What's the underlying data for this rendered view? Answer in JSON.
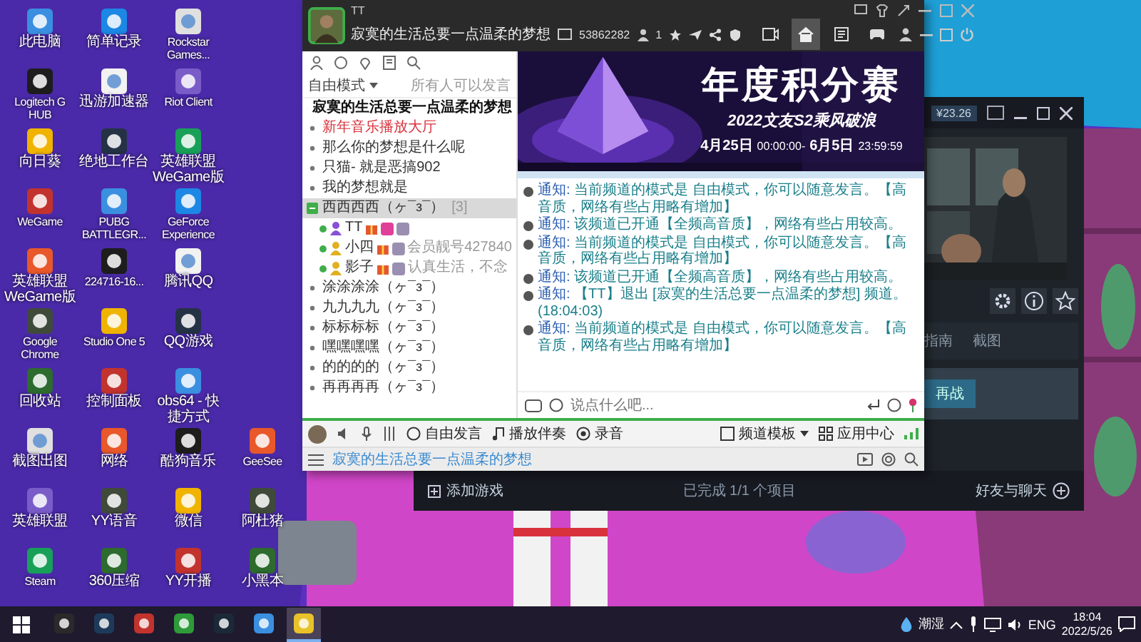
{
  "desktop": {
    "icon_columns": [
      [
        {
          "label": "此电脑"
        },
        {
          "label": "Logitech G HUB"
        },
        {
          "label": "向日葵"
        },
        {
          "label": "WeGame"
        },
        {
          "label": "英雄联盟 WeGame版"
        },
        {
          "label": "Google Chrome"
        },
        {
          "label": "回收站"
        },
        {
          "label": "截图出图"
        },
        {
          "label": "英雄联盟"
        },
        {
          "label": "Steam"
        }
      ],
      [
        {
          "label": "简单记录"
        },
        {
          "label": "迅游加速器"
        },
        {
          "label": "绝地工作台"
        },
        {
          "label": "PUBG BATTLEGR..."
        },
        {
          "label": "224716-16..."
        },
        {
          "label": "Studio One 5"
        },
        {
          "label": "控制面板"
        },
        {
          "label": "网络"
        },
        {
          "label": "YY语音"
        },
        {
          "label": "360压缩"
        }
      ],
      [
        {
          "label": "Rockstar Games..."
        },
        {
          "label": "Riot Client"
        },
        {
          "label": "英雄联盟 WeGame版"
        },
        {
          "label": "GeForce Experience"
        },
        {
          "label": "腾讯QQ"
        },
        {
          "label": "QQ游戏"
        },
        {
          "label": "obs64 - 快捷方式"
        },
        {
          "label": "酷狗音乐"
        },
        {
          "label": "微信"
        },
        {
          "label": "YY开播"
        }
      ],
      [
        {
          "label": "GeeSee"
        },
        {
          "label": "阿杜猪"
        },
        {
          "label": "小黑本"
        }
      ]
    ]
  },
  "chat_window": {
    "user_tag": "TT",
    "channel_title": "寂寞的生活总要一点温柔的梦想",
    "channel_id": "53862282",
    "online_count": "1",
    "nav": [
      {
        "selected": false
      },
      {
        "selected": true
      },
      {
        "selected": false
      },
      {
        "selected": false
      }
    ],
    "mode": "自由模式",
    "mode_note": "所有人可以发言",
    "channels": [
      {
        "kind": "root",
        "name": "寂寞的生活总要一点温柔的梦想",
        "color": "#111111",
        "selected": false,
        "expanded": false
      },
      {
        "kind": "channel",
        "name": "新年音乐播放大厅",
        "color": "#d8323c",
        "selected": false,
        "expanded": false
      },
      {
        "kind": "channel",
        "name": "那么你的梦想是什么呢",
        "color": "#333333",
        "selected": false,
        "expanded": false
      },
      {
        "kind": "channel",
        "name": "只猫- 就是恶搞902",
        "color": "#333333",
        "selected": false,
        "expanded": false
      },
      {
        "kind": "channel",
        "name": "我的梦想就是",
        "color": "#333333",
        "selected": false,
        "expanded": false
      },
      {
        "kind": "group",
        "name": "西西西西（ヶ¯з¯）",
        "count": "[3]",
        "color": "#333333",
        "selected": true,
        "expanded": true,
        "children": [
          {
            "name": "TT",
            "kind": "admin"
          },
          {
            "name": "小四",
            "kind": "member",
            "note": "会员靓号427840"
          },
          {
            "name": "影子",
            "kind": "member",
            "note": "认真生活，不念"
          }
        ]
      },
      {
        "kind": "channel",
        "name": "涂涂涂涂（ヶ¯з¯）",
        "color": "#333333",
        "selected": false,
        "expanded": false
      },
      {
        "kind": "channel",
        "name": "九九九九（ヶ¯з¯）",
        "color": "#333333",
        "selected": false,
        "expanded": false
      },
      {
        "kind": "channel",
        "name": "标标标标（ヶ¯з¯）",
        "color": "#333333",
        "selected": false,
        "expanded": false
      },
      {
        "kind": "channel",
        "name": "嘿嘿嘿嘿（ヶ¯з¯）",
        "color": "#333333",
        "selected": false,
        "expanded": false
      },
      {
        "kind": "channel",
        "name": "的的的的（ヶ¯з¯）",
        "color": "#333333",
        "selected": false,
        "expanded": false
      },
      {
        "kind": "channel",
        "name": "再再再再（ヶ¯з¯）",
        "color": "#333333",
        "selected": false,
        "expanded": false
      }
    ],
    "banner": {
      "title": "年度积分赛",
      "subtitle": "2022文友S2乘风破浪",
      "start_date": "4月25日",
      "start_time": "00:00:00-",
      "end_date": "6月5日",
      "end_time": "23:59:59"
    },
    "messages": [
      {
        "label": "通知:",
        "text": "当前频道的模式是 自由模式，你可以随意发言。【高音质，网络有些占用略有增加】"
      },
      {
        "label": "通知:",
        "text": "该频道已开通【全频高音质】，网络有些占用较高。"
      },
      {
        "label": "通知:",
        "text": "当前频道的模式是 自由模式，你可以随意发言。【高音质，网络有些占用略有增加】"
      },
      {
        "label": "通知:",
        "text": "该频道已开通【全频高音质】，网络有些占用较高。"
      },
      {
        "label": "通知:",
        "text": "【TT】退出 [寂寞的生活总要一点温柔的梦想] 频道。(18:04:03)"
      },
      {
        "label": "通知:",
        "text": "当前频道的模式是 自由模式，你可以随意发言。【高音质，网络有些占用略有增加】"
      }
    ],
    "input": {
      "placeholder": "说点什么吧..."
    },
    "toolbar": {
      "speak_mode": "自由发言",
      "accompaniment": "播放伴奏",
      "record": "录音",
      "template": "频道模板",
      "apps": "应用中心"
    },
    "footer_link": "寂寞的生活总要一点温柔的梦想"
  },
  "steam_window": {
    "balance": "¥23.26",
    "tabs": [
      {
        "label": "指南",
        "selected": false
      },
      {
        "label": "截图",
        "selected": false
      }
    ],
    "action": "再战",
    "add_game": "添加游戏",
    "downloads": "已完成 1/1 个项目",
    "friends": "好友与聊天"
  },
  "taskbar": {
    "apps": [
      {
        "selected": false
      },
      {
        "selected": false
      },
      {
        "selected": false
      },
      {
        "selected": false
      },
      {
        "selected": false
      },
      {
        "selected": false
      },
      {
        "selected": true
      }
    ],
    "weather": "潮湿",
    "language": "ENG",
    "time": "18:04",
    "date": "2022/5/26"
  }
}
